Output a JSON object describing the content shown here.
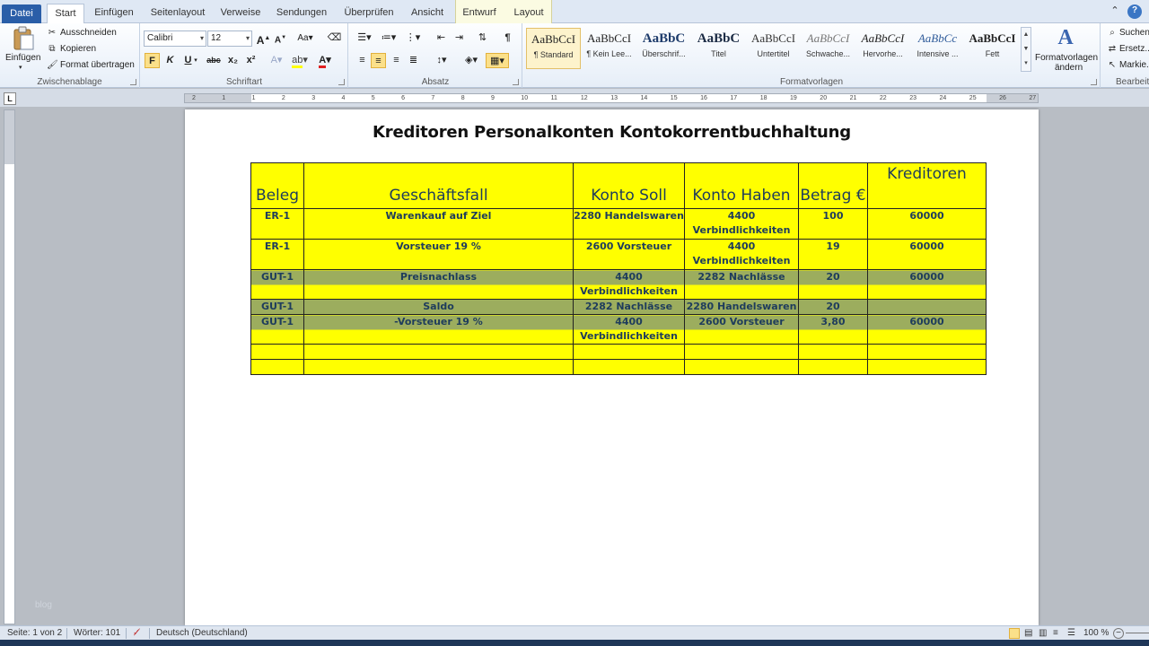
{
  "tabs": {
    "datei": "Datei",
    "start": "Start",
    "einfuegen": "Einfügen",
    "seitenlayout": "Seitenlayout",
    "verweise": "Verweise",
    "sendungen": "Sendungen",
    "ueberpruefen": "Überprüfen",
    "ansicht": "Ansicht",
    "entwurf": "Entwurf",
    "layout": "Layout"
  },
  "clipboard": {
    "paste_label": "Einfügen",
    "cut_label": "Ausschneiden",
    "copy_label": "Kopieren",
    "format_painter_label": "Format übertragen",
    "group_label": "Zwischenablage"
  },
  "font": {
    "font_name": "Calibri",
    "font_size": "12",
    "bold": "F",
    "italic": "K",
    "underline": "U",
    "strikethrough": "abc",
    "subscript": "x₂",
    "superscript": "x²",
    "group_label": "Schriftart"
  },
  "paragraph": {
    "group_label": "Absatz"
  },
  "styles": {
    "group_label": "Formatvorlagen",
    "items": [
      {
        "preview": "AaBbCcI",
        "name": "¶ Standard"
      },
      {
        "preview": "AaBbCcI",
        "name": "¶ Kein Lee..."
      },
      {
        "preview": "AaBbC",
        "name": "Überschrif..."
      },
      {
        "preview": "AaBbC",
        "name": "Titel"
      },
      {
        "preview": "AaBbCcI",
        "name": "Untertitel"
      },
      {
        "preview": "AaBbCcI",
        "name": "Schwache..."
      },
      {
        "preview": "AaBbCcI",
        "name": "Hervorhe..."
      },
      {
        "preview": "AaBbCc",
        "name": "Intensive ..."
      },
      {
        "preview": "AaBbCcI",
        "name": "Fett"
      }
    ],
    "change_styles_line1": "Formatvorlagen",
    "change_styles_line2": "ändern"
  },
  "editing": {
    "find_label": "Suchen",
    "replace_label": "Ersetz...",
    "select_label": "Markie...",
    "group_label": "Bearbeiten"
  },
  "ruler": {
    "ticks": [
      "2",
      "1",
      "1",
      "2",
      "3",
      "4",
      "5",
      "6",
      "7",
      "8",
      "9",
      "10",
      "11",
      "12",
      "13",
      "14",
      "15",
      "16",
      "17",
      "18",
      "19",
      "20",
      "21",
      "22",
      "23",
      "24",
      "25",
      "26",
      "27"
    ]
  },
  "document": {
    "title": "Kreditoren Personalkonten Kontokorrentbuchhaltung",
    "table": {
      "headers": [
        "Beleg",
        "Geschäftsfall",
        "Konto Soll",
        "Konto Haben",
        "Betrag €",
        "Kreditoren"
      ],
      "rows": [
        [
          "ER-1",
          "Warenkauf auf Ziel",
          "2280 Handelswaren",
          "4400 Verbindlichkeiten",
          "100",
          "60000"
        ],
        [
          "ER-1",
          "Vorsteuer 19 %",
          "2600 Vorsteuer",
          "4400 Verbindlichkeiten",
          "19",
          "60000"
        ],
        [
          "GUT-1",
          "Preisnachlass",
          "4400 Verbindlichkeiten",
          "2282 Nachlässe",
          "20",
          "60000"
        ],
        [
          "GUT-1",
          "Saldo",
          "2282 Nachlässe",
          "2280 Handelswaren",
          "20",
          ""
        ],
        [
          "GUT-1",
          "-Vorsteuer 19 %",
          "4400 Verbindlichkeiten",
          "2600 Vorsteuer",
          "3,80",
          "60000"
        ],
        [
          "",
          "",
          "",
          "",
          "",
          ""
        ],
        [
          "",
          "",
          "",
          "",
          "",
          ""
        ]
      ]
    }
  },
  "status": {
    "page": "Seite: 1 von 2",
    "words": "Wörter: 101",
    "language": "Deutsch (Deutschland)",
    "zoom": "100 %"
  },
  "watermark": "blog",
  "colors": {
    "table_fill": "#ffff00",
    "highlight_rows": "#9cad5e",
    "cell_text": "#1e3c5c",
    "file_tab": "#2a5ea8"
  }
}
